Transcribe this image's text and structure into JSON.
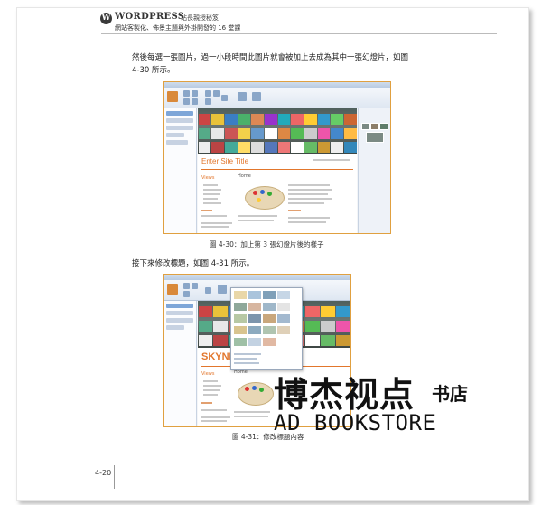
{
  "header": {
    "logo_letter": "W",
    "brand": "WORDPRESS",
    "subtitle_1": "站長親授秘笈",
    "subtitle_2": "網站客製化、佈景主題與外掛開發的 16 堂課"
  },
  "paragraph_1_line1": "然後每選一張圖片，過一小段時間此圖片就會被加上去成為其中一張幻燈片，如圖",
  "paragraph_1_line2": "4-30 所示。",
  "figure_1": {
    "caption": "圖 4-30：加上第 3 張幻燈片後的樣子",
    "site_title": "Enter Site Title",
    "sidebar_heading": "Views",
    "content_heading": "Home"
  },
  "paragraph_2": "接下來修改標題，如圖 4-31 所示。",
  "figure_2": {
    "caption": "圖 4-31：修改標題內容",
    "site_title": "SKYNE",
    "sidebar_heading": "Views",
    "content_heading": "Home"
  },
  "page_number": "4-20",
  "watermark": {
    "chinese": "博杰视点",
    "chinese_small": "书店",
    "english": "AD BOOKSTORE"
  }
}
